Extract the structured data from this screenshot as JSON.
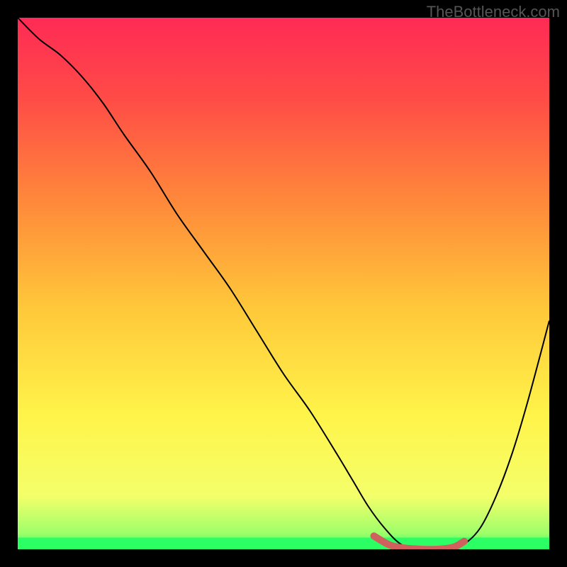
{
  "watermark": "TheBottleneck.com",
  "chart_data": {
    "type": "line",
    "title": "",
    "xlabel": "",
    "ylabel": "",
    "xlim": [
      0,
      100
    ],
    "ylim": [
      0,
      100
    ],
    "series": [
      {
        "name": "curve",
        "x": [
          0,
          4,
          8,
          12,
          16,
          20,
          25,
          30,
          35,
          40,
          45,
          50,
          55,
          60,
          63,
          66,
          69,
          72,
          75,
          78,
          81,
          84,
          87,
          90,
          93,
          96,
          100
        ],
        "y": [
          100,
          96,
          93,
          89,
          84,
          78,
          71,
          63,
          56,
          49,
          41,
          33,
          26,
          18,
          13,
          8,
          4,
          1,
          0,
          0,
          0,
          1,
          4,
          10,
          18,
          28,
          43
        ]
      }
    ],
    "highlight": {
      "name": "flat-min-segment",
      "color": "#d0605e",
      "x": [
        67,
        70,
        73,
        76,
        79,
        82,
        84
      ],
      "y": [
        2.5,
        0.8,
        0.2,
        0.0,
        0.0,
        0.4,
        1.5
      ]
    },
    "gradient_stops": [
      {
        "offset": 0.0,
        "color": "#ff2a55"
      },
      {
        "offset": 0.15,
        "color": "#ff4b47"
      },
      {
        "offset": 0.35,
        "color": "#ff8a3a"
      },
      {
        "offset": 0.55,
        "color": "#ffc93a"
      },
      {
        "offset": 0.75,
        "color": "#fff44a"
      },
      {
        "offset": 0.9,
        "color": "#f4ff6a"
      },
      {
        "offset": 0.97,
        "color": "#9dff6a"
      },
      {
        "offset": 1.0,
        "color": "#2bff63"
      }
    ],
    "green_band": {
      "y": 0.0,
      "height_frac": 0.022
    }
  }
}
